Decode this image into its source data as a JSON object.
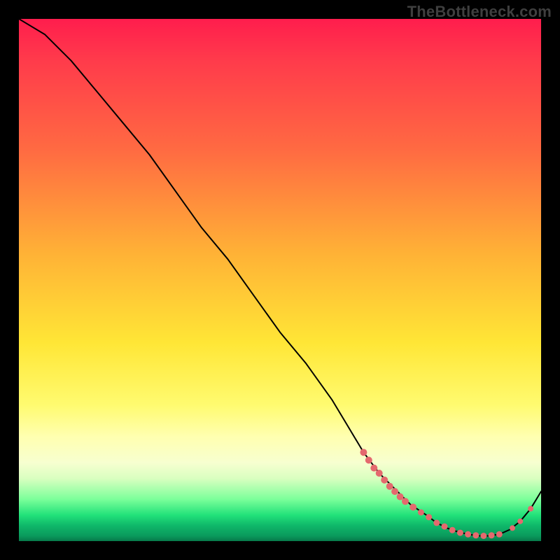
{
  "watermark": "TheBottleneck.com",
  "chart_data": {
    "type": "line",
    "title": "",
    "xlabel": "",
    "ylabel": "",
    "xlim": [
      0,
      100
    ],
    "ylim": [
      0,
      100
    ],
    "grid": false,
    "legend": false,
    "series": [
      {
        "name": "curve",
        "x": [
          0,
          5,
          10,
          15,
          20,
          25,
          30,
          35,
          40,
          45,
          50,
          55,
          60,
          63,
          66,
          69,
          72,
          75,
          78,
          80,
          82,
          84,
          86,
          88,
          90,
          92,
          94,
          96,
          98,
          100
        ],
        "y": [
          100,
          97,
          92,
          86,
          80,
          74,
          67,
          60,
          54,
          47,
          40,
          34,
          27,
          22,
          17,
          13,
          10,
          7,
          5,
          3.5,
          2.5,
          1.8,
          1.3,
          1.0,
          1.0,
          1.3,
          2.2,
          3.8,
          6.2,
          9.5
        ],
        "color": "#000000",
        "width": 2
      }
    ],
    "markers": [
      {
        "x": 66,
        "y": 17,
        "r": 5
      },
      {
        "x": 67,
        "y": 15.5,
        "r": 5
      },
      {
        "x": 68,
        "y": 14,
        "r": 5
      },
      {
        "x": 69,
        "y": 13,
        "r": 5
      },
      {
        "x": 70,
        "y": 11.7,
        "r": 5
      },
      {
        "x": 71,
        "y": 10.5,
        "r": 5
      },
      {
        "x": 72,
        "y": 9.5,
        "r": 5
      },
      {
        "x": 73,
        "y": 8.5,
        "r": 5
      },
      {
        "x": 74,
        "y": 7.6,
        "r": 5
      },
      {
        "x": 75.5,
        "y": 6.5,
        "r": 5
      },
      {
        "x": 77,
        "y": 5.5,
        "r": 4.5
      },
      {
        "x": 78.5,
        "y": 4.6,
        "r": 4.5
      },
      {
        "x": 80,
        "y": 3.5,
        "r": 4.5
      },
      {
        "x": 81.5,
        "y": 2.8,
        "r": 4.5
      },
      {
        "x": 83,
        "y": 2.1,
        "r": 4.5
      },
      {
        "x": 84.5,
        "y": 1.6,
        "r": 4.5
      },
      {
        "x": 86,
        "y": 1.3,
        "r": 4.5
      },
      {
        "x": 87.5,
        "y": 1.1,
        "r": 4.5
      },
      {
        "x": 89,
        "y": 1.0,
        "r": 4.5
      },
      {
        "x": 90.5,
        "y": 1.1,
        "r": 4.5
      },
      {
        "x": 92,
        "y": 1.3,
        "r": 4.5
      },
      {
        "x": 94.5,
        "y": 2.5,
        "r": 4
      },
      {
        "x": 96,
        "y": 3.8,
        "r": 4
      },
      {
        "x": 98,
        "y": 6.2,
        "r": 4
      }
    ],
    "marker_color": "#e4696e"
  }
}
